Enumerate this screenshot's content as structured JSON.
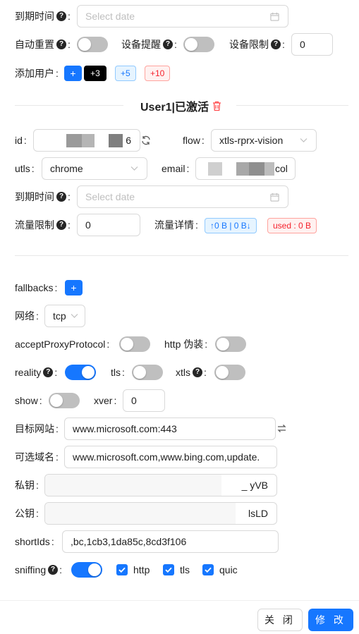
{
  "expiry": {
    "label": "到期时间",
    "placeholder": "Select date"
  },
  "auto_reset": {
    "label": "自动重置"
  },
  "device_alert": {
    "label": "设备提醒"
  },
  "device_limit": {
    "label": "设备限制",
    "value": "0"
  },
  "add_user": {
    "label": "添加用户",
    "plus": "+",
    "p3": "+3",
    "p5": "+5",
    "p10": "+10"
  },
  "user_section": {
    "title": "User1|已激活"
  },
  "user": {
    "id_label": "id",
    "id_value_tail": "6",
    "flow_label": "flow",
    "flow_value": "xtls-rprx-vision",
    "utls_label": "utls",
    "utls_value": "chrome",
    "email_label": "email",
    "email_value_tail": "col",
    "expiry_label": "到期时间",
    "expiry_placeholder": "Select date",
    "traffic_limit_label": "流量限制",
    "traffic_limit_value": "0",
    "traffic_detail_label": "流量详情",
    "traffic_detail_tag": "↑0 B | 0 B↓",
    "used_tag": "used : 0 B"
  },
  "fallbacks": {
    "label": "fallbacks",
    "add": "+"
  },
  "network": {
    "label": "网络",
    "value": "tcp"
  },
  "accept_proxy": {
    "label": "acceptProxyProtocol"
  },
  "http_camouflage": {
    "label": "http 伪装"
  },
  "reality": {
    "label": "reality",
    "on": true
  },
  "tls": {
    "label": "tls"
  },
  "xtls": {
    "label": "xtls"
  },
  "show": {
    "label": "show"
  },
  "xver": {
    "label": "xver",
    "value": "0"
  },
  "target_site": {
    "label": "目标网站",
    "value": "www.microsoft.com:443"
  },
  "server_names": {
    "label": "可选域名",
    "value": "www.microsoft.com,www.bing.com,update."
  },
  "private_key": {
    "label": "私钥",
    "value_tail": "_ yVB"
  },
  "public_key": {
    "label": "公钥",
    "value_tail": "lsLD"
  },
  "short_ids": {
    "label": "shortIds",
    "value": ",bc,1cb3,1da85c,8cd3f106"
  },
  "sniffing": {
    "label": "sniffing",
    "on": true,
    "opt_http": "http",
    "opt_tls": "tls",
    "opt_quic": "quic"
  },
  "footer": {
    "close": "关 闭",
    "modify": "修 改"
  },
  "colors": {
    "primary": "#1677ff",
    "danger": "#ff4d4f",
    "black": "#000000"
  }
}
